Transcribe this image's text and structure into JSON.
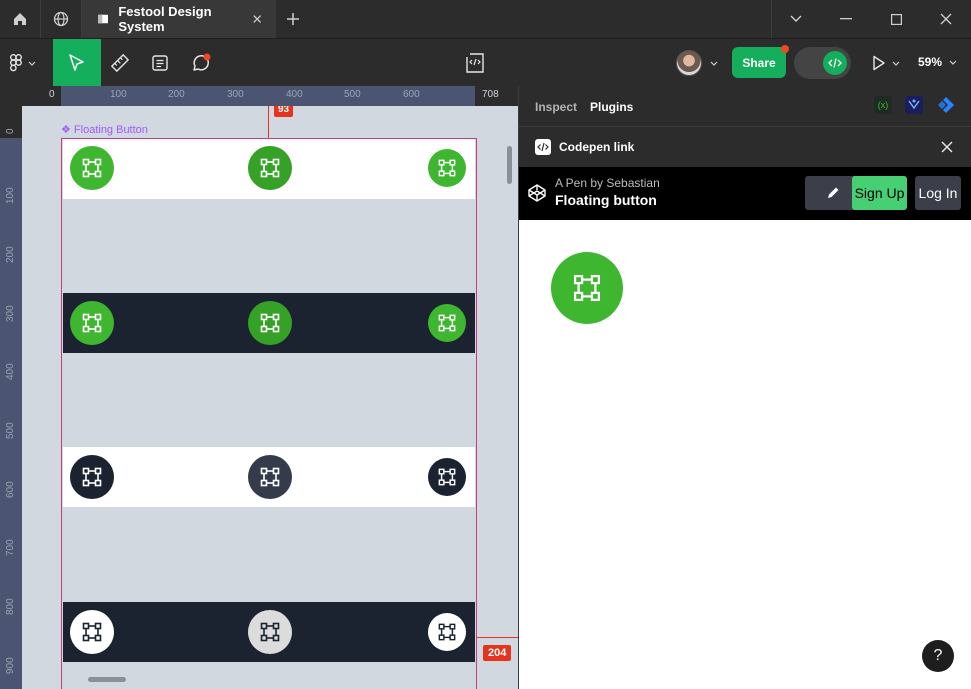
{
  "window": {
    "tab_title": "Festool Design System"
  },
  "toolbar": {
    "share_label": "Share",
    "zoom_label": "59%"
  },
  "rulers": {
    "h_ticks": [
      "0",
      "100",
      "200",
      "300",
      "400",
      "500",
      "600",
      "708"
    ],
    "v_ticks": [
      "0",
      "100",
      "200",
      "300",
      "400",
      "500",
      "600",
      "700",
      "800",
      "900"
    ],
    "x_marker": "93",
    "y_marker": "204"
  },
  "canvas": {
    "frame_label": "❖ Floating Button"
  },
  "panel": {
    "tabs": [
      "Inspect",
      "Plugins"
    ],
    "active_tab": "Plugins",
    "plugin_title": "Codepen link",
    "pen_byline": "A Pen by Sebastian",
    "pen_title": "Floating button",
    "signup_label": "Sign Up",
    "login_label": "Log In",
    "help_label": "?"
  },
  "colors": {
    "brand_green": "#3fb62f",
    "share_green": "#14ae5c",
    "dark_navy": "#1b2330",
    "frame_border": "#c63b82",
    "marker_red": "#e5331e",
    "frame_label_purple": "#a259ff"
  }
}
